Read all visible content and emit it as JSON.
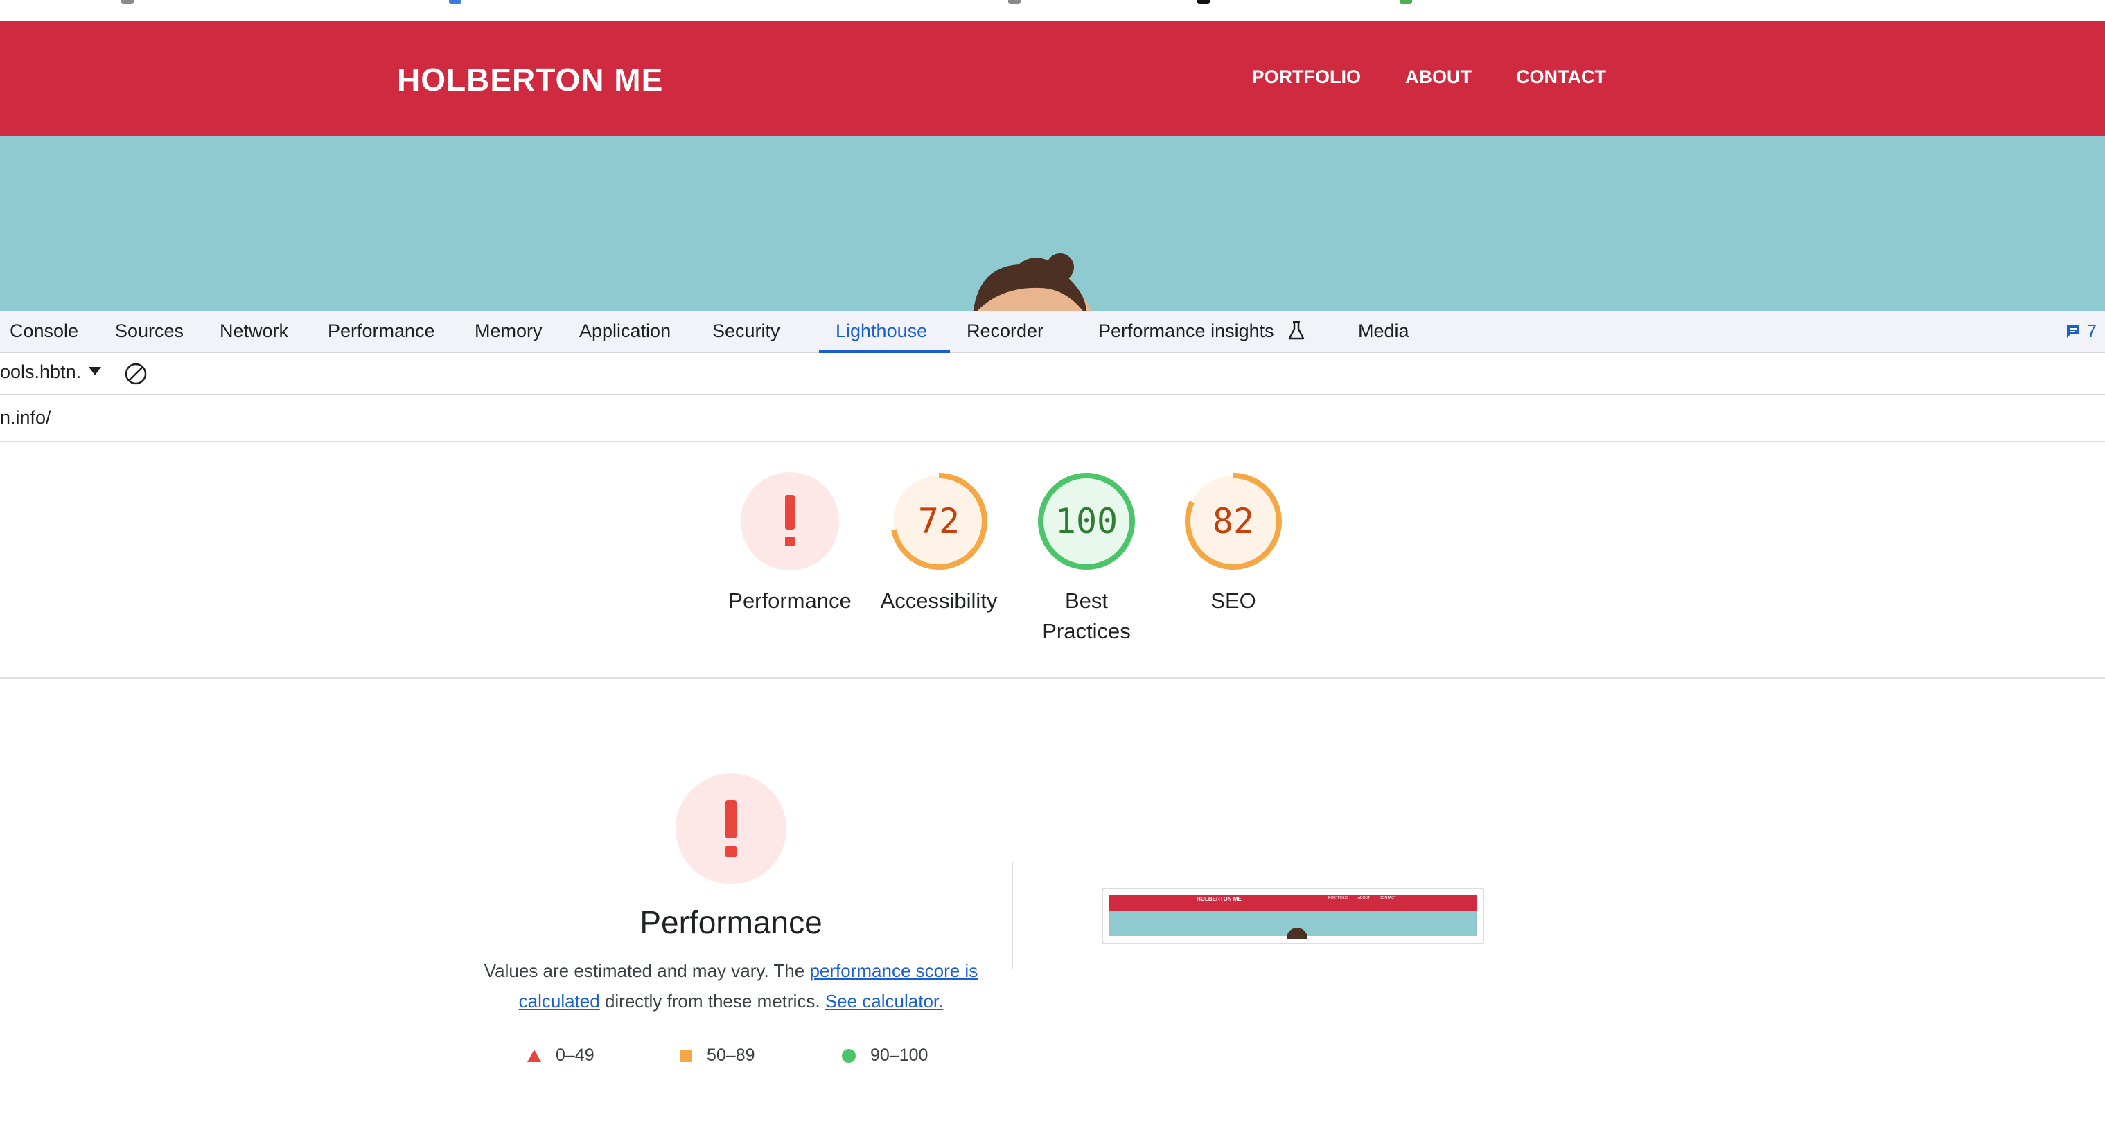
{
  "site": {
    "title": "HOLBERTON ME",
    "nav": [
      "PORTFOLIO",
      "ABOUT",
      "CONTACT"
    ],
    "colors": {
      "header": "#cf2a40",
      "hero": "#8fcad1"
    }
  },
  "devtools": {
    "tabs": [
      "Console",
      "Sources",
      "Network",
      "Performance",
      "Memory",
      "Application",
      "Security",
      "Lighthouse",
      "Recorder",
      "Performance insights",
      "Media"
    ],
    "active_tab": "Lighthouse",
    "issues_count": "7",
    "toolbar_select": "ools.hbtn.",
    "url": "n.info/"
  },
  "scores": [
    {
      "label": "Performance",
      "value": "!",
      "status": "fail"
    },
    {
      "label": "Accessibility",
      "value": "72",
      "status": "average"
    },
    {
      "label": "Best Practices",
      "label_line1": "Best",
      "label_line2": "Practices",
      "value": "100",
      "status": "pass"
    },
    {
      "label": "SEO",
      "value": "82",
      "status": "average"
    }
  ],
  "performance_section": {
    "title": "Performance",
    "desc_prefix": "Values are estimated and may vary. The ",
    "desc_link1": "performance score is calculated",
    "desc_middle": " directly from these metrics. ",
    "desc_link2": "See calculator.",
    "legend": [
      {
        "range": "0–49",
        "shape": "triangle",
        "color": "#e8453c"
      },
      {
        "range": "50–89",
        "shape": "square",
        "color": "#f4a742"
      },
      {
        "range": "90–100",
        "shape": "circle",
        "color": "#4cc46a"
      }
    ]
  },
  "thumbnail": {
    "title": "HOLBERTON ME",
    "nav": [
      "PORTFOLIO",
      "ABOUT",
      "CONTACT"
    ]
  }
}
